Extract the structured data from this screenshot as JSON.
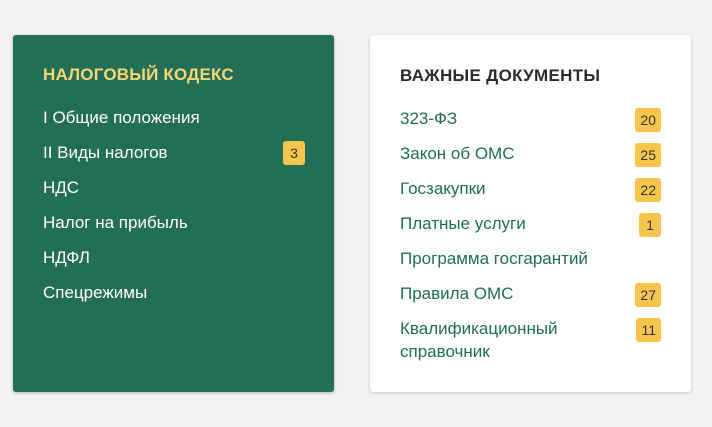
{
  "tax_code": {
    "title": "НАЛОГОВЫЙ КОДЕКС",
    "items": [
      {
        "label": "I Общие положения",
        "badge": null
      },
      {
        "label": "II Виды налогов",
        "badge": "3"
      },
      {
        "label": "НДС",
        "badge": null
      },
      {
        "label": "Налог на прибыль",
        "badge": null
      },
      {
        "label": "НДФЛ",
        "badge": null
      },
      {
        "label": "Спецрежимы",
        "badge": null
      }
    ]
  },
  "documents": {
    "title": "ВАЖНЫЕ ДОКУМЕНТЫ",
    "items": [
      {
        "label": "323-ФЗ",
        "badge": "20"
      },
      {
        "label": "Закон об ОМС",
        "badge": "25"
      },
      {
        "label": "Госзакупки",
        "badge": "22"
      },
      {
        "label": "Платные услуги",
        "badge": "1"
      },
      {
        "label": "Программа госгарантий",
        "badge": null
      },
      {
        "label": "Правила ОМС",
        "badge": "27"
      },
      {
        "label": "Квалификационный справочник",
        "badge": "11"
      }
    ]
  },
  "colors": {
    "tax_card_bg": "#226e57",
    "tax_title": "#f7d774",
    "badge_bg": "#f7c54c",
    "doc_link": "#1f6e57",
    "page_bg": "#f2f2f2"
  }
}
